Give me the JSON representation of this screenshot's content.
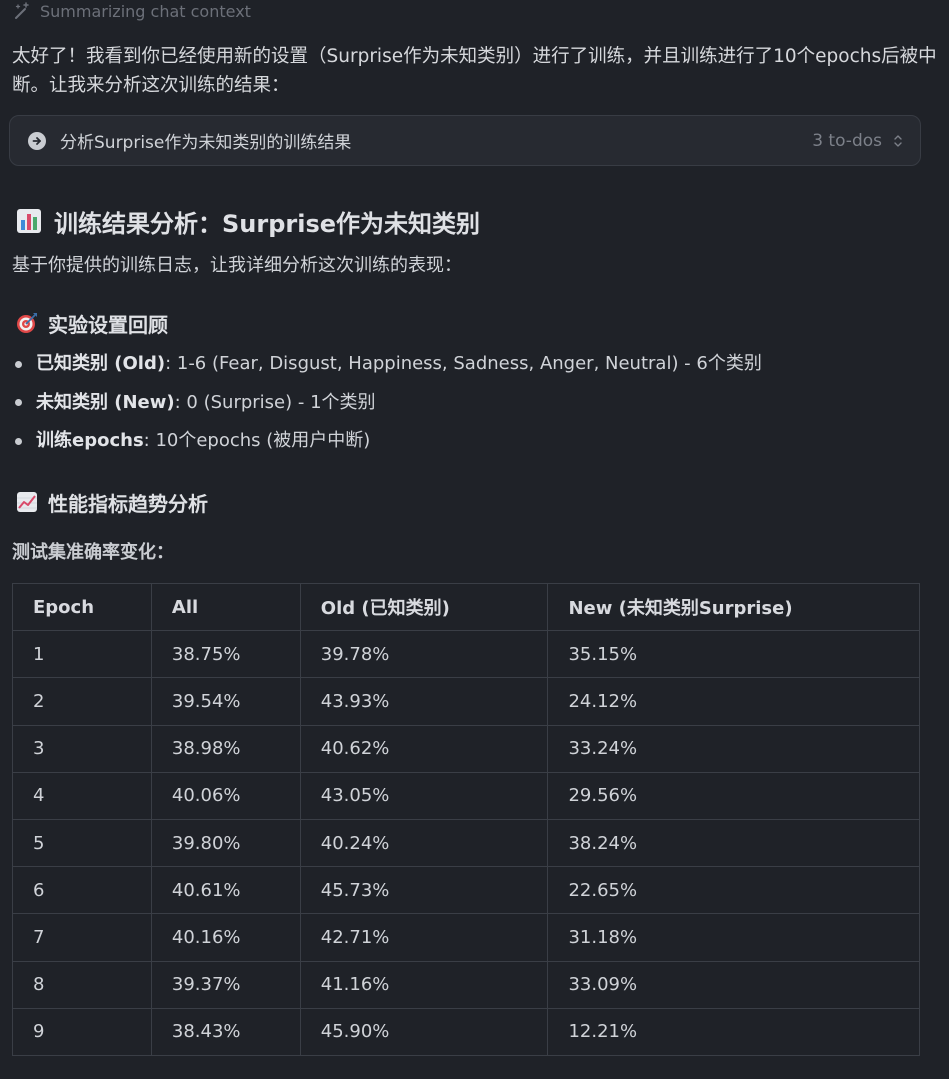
{
  "status": {
    "icon": "wand-icon",
    "text": "Summarizing chat context"
  },
  "intro": {
    "text": "太好了！我看到你已经使用新的设置（Surprise作为未知类别）进行了训练，并且训练进行了10个epochs后被中断。让我来分析这次训练的结果："
  },
  "todo": {
    "icon": "arrow-right-circle-icon",
    "label": "分析Surprise作为未知类别的训练结果",
    "count": "3 to-dos"
  },
  "section_title": {
    "icon": "bar-chart-icon",
    "text": "训练结果分析：Surprise作为未知类别"
  },
  "section_sub": "基于你提供的训练日志，让我详细分析这次训练的表现：",
  "setup": {
    "icon": "target-icon",
    "title": "实验设置回顾",
    "items": [
      {
        "bold": "已知类别 (Old)",
        "rest": ": 1-6 (Fear, Disgust, Happiness, Sadness, Anger, Neutral) - 6个类别"
      },
      {
        "bold": "未知类别 (New)",
        "rest": ": 0 (Surprise) - 1个类别"
      },
      {
        "bold": "训练epochs",
        "rest": ": 10个epochs (被用户中断)"
      }
    ]
  },
  "trend": {
    "icon": "trend-up-icon",
    "title": "性能指标趋势分析"
  },
  "table_caption": "测试集准确率变化：",
  "table": {
    "headers": [
      "Epoch",
      "All",
      "Old (已知类别)",
      "New (未知类别Surprise)"
    ],
    "rows": [
      [
        "1",
        "38.75%",
        "39.78%",
        "35.15%"
      ],
      [
        "2",
        "39.54%",
        "43.93%",
        "24.12%"
      ],
      [
        "3",
        "38.98%",
        "40.62%",
        "33.24%"
      ],
      [
        "4",
        "40.06%",
        "43.05%",
        "29.56%"
      ],
      [
        "5",
        "39.80%",
        "40.24%",
        "38.24%"
      ],
      [
        "6",
        "40.61%",
        "45.73%",
        "22.65%"
      ],
      [
        "7",
        "40.16%",
        "42.71%",
        "31.18%"
      ],
      [
        "8",
        "39.37%",
        "41.16%",
        "33.09%"
      ],
      [
        "9",
        "38.43%",
        "45.90%",
        "12.21%"
      ]
    ]
  }
}
